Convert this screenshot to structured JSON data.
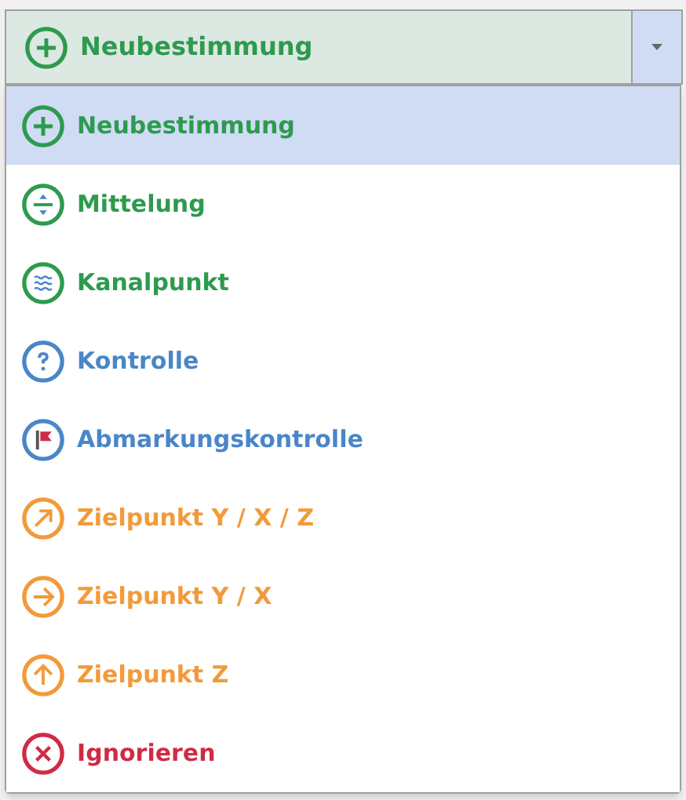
{
  "combo": {
    "label": "Neubestimmung",
    "kind": "plus",
    "color": "#2e9a4e",
    "expanded": true
  },
  "options": [
    {
      "label": "Neubestimmung",
      "kind": "plus",
      "color": "#2e9a4e",
      "selected": true
    },
    {
      "label": "Mittelung",
      "kind": "average",
      "color": "#2e9a4e",
      "selected": false
    },
    {
      "label": "Kanalpunkt",
      "kind": "waves",
      "color": "#2e9a4e",
      "selected": false
    },
    {
      "label": "Kontrolle",
      "kind": "question",
      "color": "#4a86c8",
      "selected": false
    },
    {
      "label": "Abmarkungskontrolle",
      "kind": "flag",
      "color": "#4a86c8",
      "selected": false
    },
    {
      "label": "Zielpunkt Y / X / Z",
      "kind": "diagonal",
      "color": "#f29a3a",
      "selected": false
    },
    {
      "label": "Zielpunkt Y / X",
      "kind": "right",
      "color": "#f29a3a",
      "selected": false
    },
    {
      "label": "Zielpunkt Z",
      "kind": "up",
      "color": "#f29a3a",
      "selected": false
    },
    {
      "label": "Ignorieren",
      "kind": "cross",
      "color": "#d02b44",
      "selected": false
    }
  ]
}
